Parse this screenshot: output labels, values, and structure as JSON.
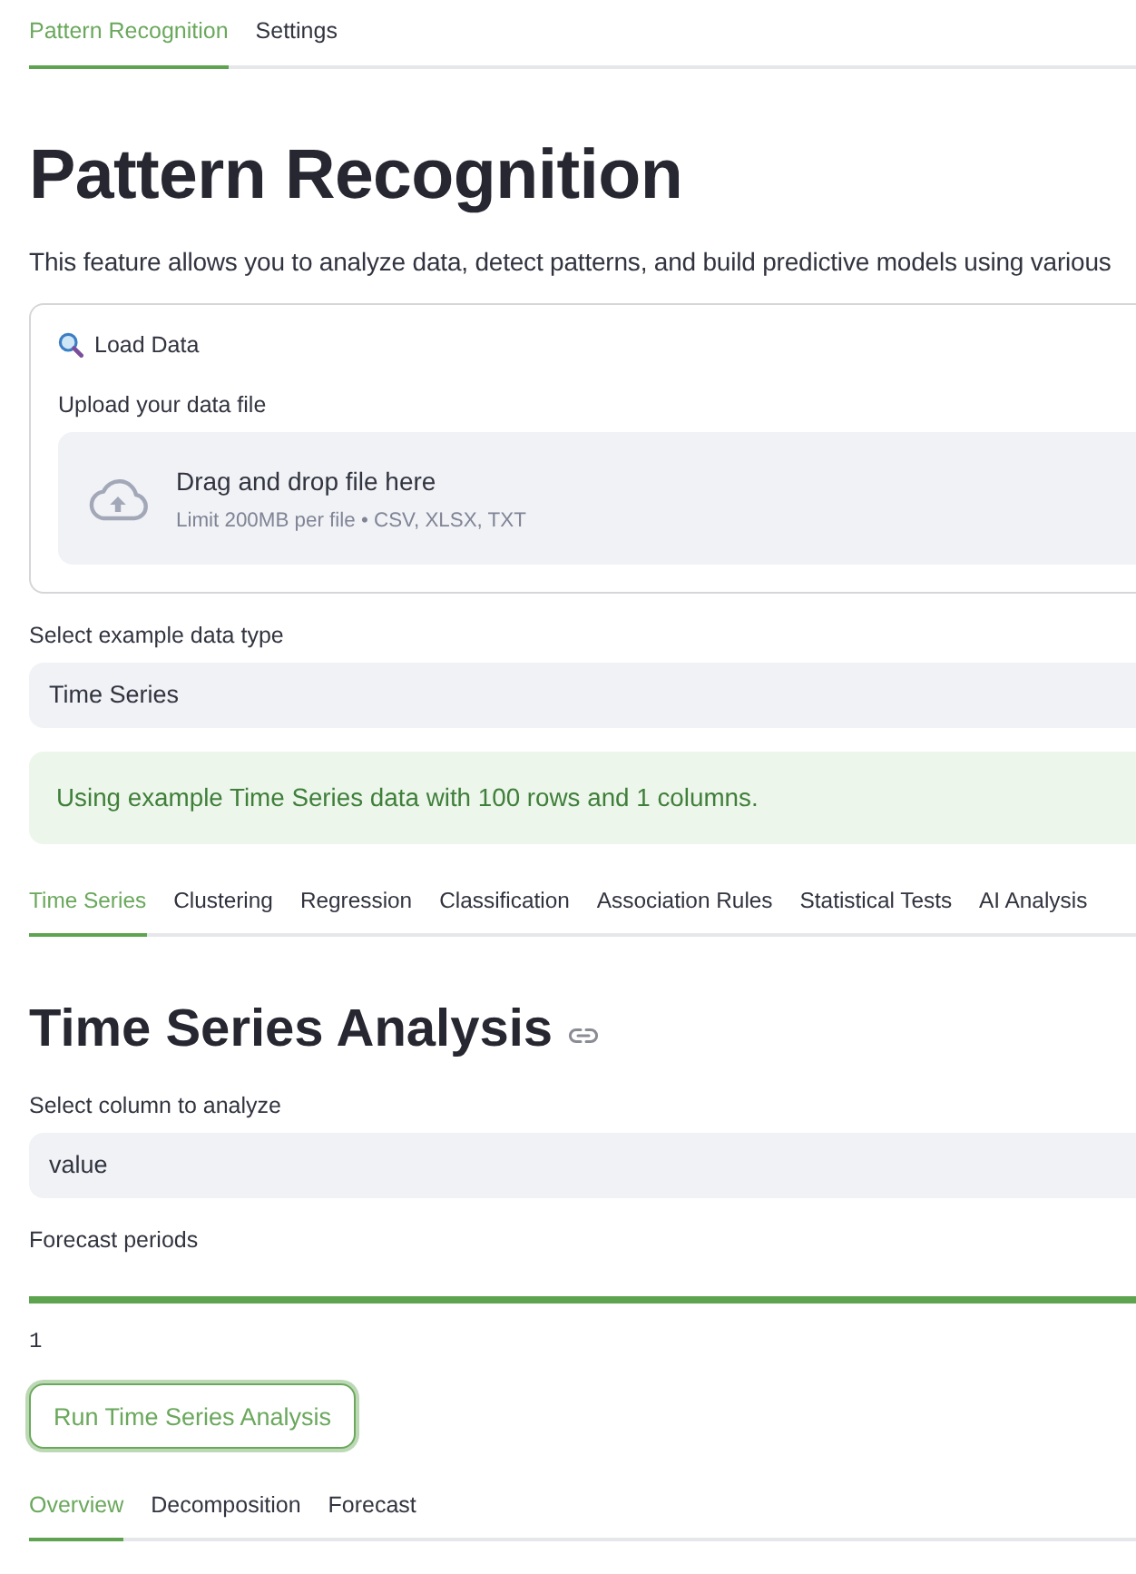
{
  "tabs": [
    {
      "label": "Pattern Recognition",
      "selected": true
    },
    {
      "label": "Settings",
      "selected": false
    }
  ],
  "title": "Pattern Recognition",
  "description": "This feature allows you to analyze data, detect patterns, and build predictive models using various",
  "load_data": {
    "title": "Load Data",
    "uploader": {
      "label": "Upload your data file",
      "prompt": "Drag and drop file here",
      "hint": "Limit 200MB per file • CSV, XLSX, TXT"
    }
  },
  "example_select": {
    "label": "Select example data type",
    "value": "Time Series"
  },
  "alert": {
    "kind": "success",
    "text": "Using example Time Series data with 100 rows and 1 columns."
  },
  "analysis_tabs": [
    {
      "label": "Time Series",
      "selected": true
    },
    {
      "label": "Clustering",
      "selected": false
    },
    {
      "label": "Regression",
      "selected": false
    },
    {
      "label": "Classification",
      "selected": false
    },
    {
      "label": "Association Rules",
      "selected": false
    },
    {
      "label": "Statistical Tests",
      "selected": false
    },
    {
      "label": "AI Analysis",
      "selected": false
    }
  ],
  "section": {
    "title": "Time Series Analysis",
    "column_select": {
      "label": "Select column to analyze",
      "value": "value"
    },
    "forecast_slider": {
      "label": "Forecast periods",
      "level": 1,
      "min_label": "1"
    },
    "run_button": "Run Time Series Analysis",
    "result_tabs": [
      {
        "label": "Overview",
        "selected": true
      },
      {
        "label": "Decomposition",
        "selected": false
      },
      {
        "label": "Forecast",
        "selected": false
      }
    ]
  }
}
